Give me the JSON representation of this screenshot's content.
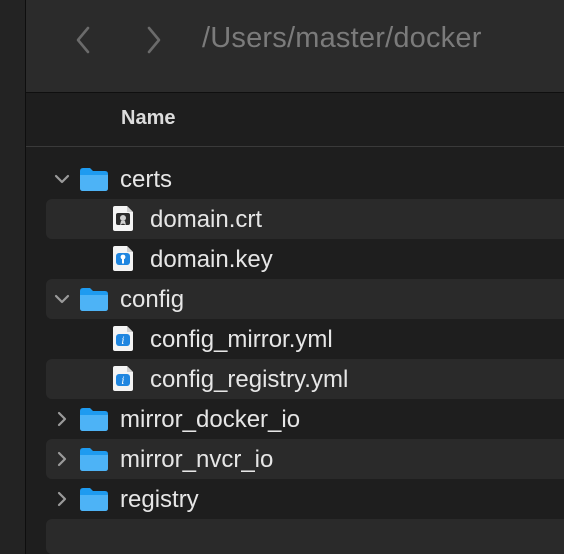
{
  "window": {
    "path_title": "/Users/master/docker"
  },
  "toolbar": {
    "back_icon": "chevron-left-icon",
    "forward_icon": "chevron-right-icon"
  },
  "list_header": {
    "name_label": "Name"
  },
  "files": [
    {
      "label": "certs",
      "kind": "folder",
      "expanded": true,
      "depth": 0
    },
    {
      "label": "domain.crt",
      "kind": "certificate",
      "depth": 1
    },
    {
      "label": "domain.key",
      "kind": "key",
      "depth": 1
    },
    {
      "label": "config",
      "kind": "folder",
      "expanded": true,
      "depth": 0
    },
    {
      "label": "config_mirror.yml",
      "kind": "text-document",
      "depth": 1
    },
    {
      "label": "config_registry.yml",
      "kind": "text-document",
      "depth": 1
    },
    {
      "label": "mirror_docker_io",
      "kind": "folder",
      "expanded": false,
      "depth": 0
    },
    {
      "label": "mirror_nvcr_io",
      "kind": "folder",
      "expanded": false,
      "depth": 0
    },
    {
      "label": "registry",
      "kind": "folder",
      "expanded": false,
      "depth": 0
    }
  ],
  "colors": {
    "folder": "#1e9bf0",
    "folder_tab": "#4db3f6",
    "row_stripe": "#2a2a2a",
    "title_text": "#7b7b7b"
  }
}
